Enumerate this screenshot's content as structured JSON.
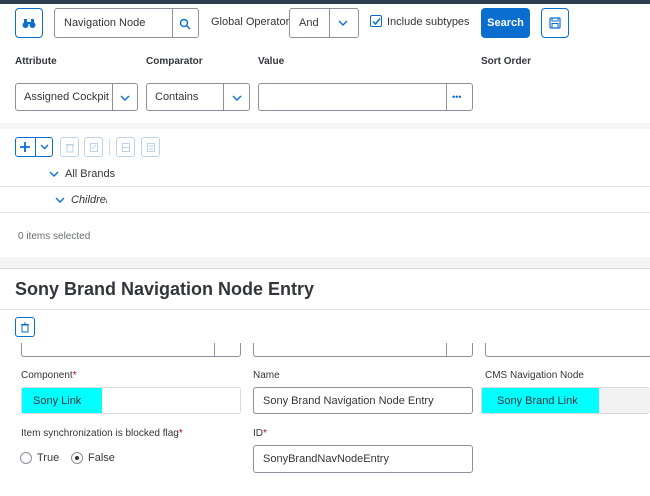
{
  "search": {
    "type_value": "Navigation Node",
    "operator_label": "Global Operator:",
    "operator_value": "And",
    "include_subtypes_label": "Include subtypes",
    "search_button": "Search",
    "headers": {
      "attribute": "Attribute",
      "comparator": "Comparator",
      "value": "Value",
      "sort_order": "Sort Order"
    },
    "attribute_value": "Assigned Cockpit Ite",
    "comparator_value": "Contains",
    "value_more": "•••"
  },
  "tree": {
    "items": [
      {
        "label": "All Brands"
      },
      {
        "label": "Children"
      }
    ],
    "selection_status": "0 items selected"
  },
  "editor": {
    "title": "Sony Brand Navigation Node Entry",
    "component_label": "Component",
    "component_value": "Sony Link",
    "name_label": "Name",
    "name_value": "Sony Brand Navigation Node Entry",
    "cms_node_label": "CMS Navigation Node",
    "cms_node_value": "Sony Brand Link",
    "sync_label": "Item synchronization is blocked flag",
    "radio_true": "True",
    "radio_false": "False",
    "id_label": "ID",
    "id_value": "SonyBrandNavNodeEntry",
    "required_mark": "*"
  },
  "colors": {
    "accent": "#0a6ed1",
    "highlight": "#00ffff",
    "required": "#bb0000"
  }
}
